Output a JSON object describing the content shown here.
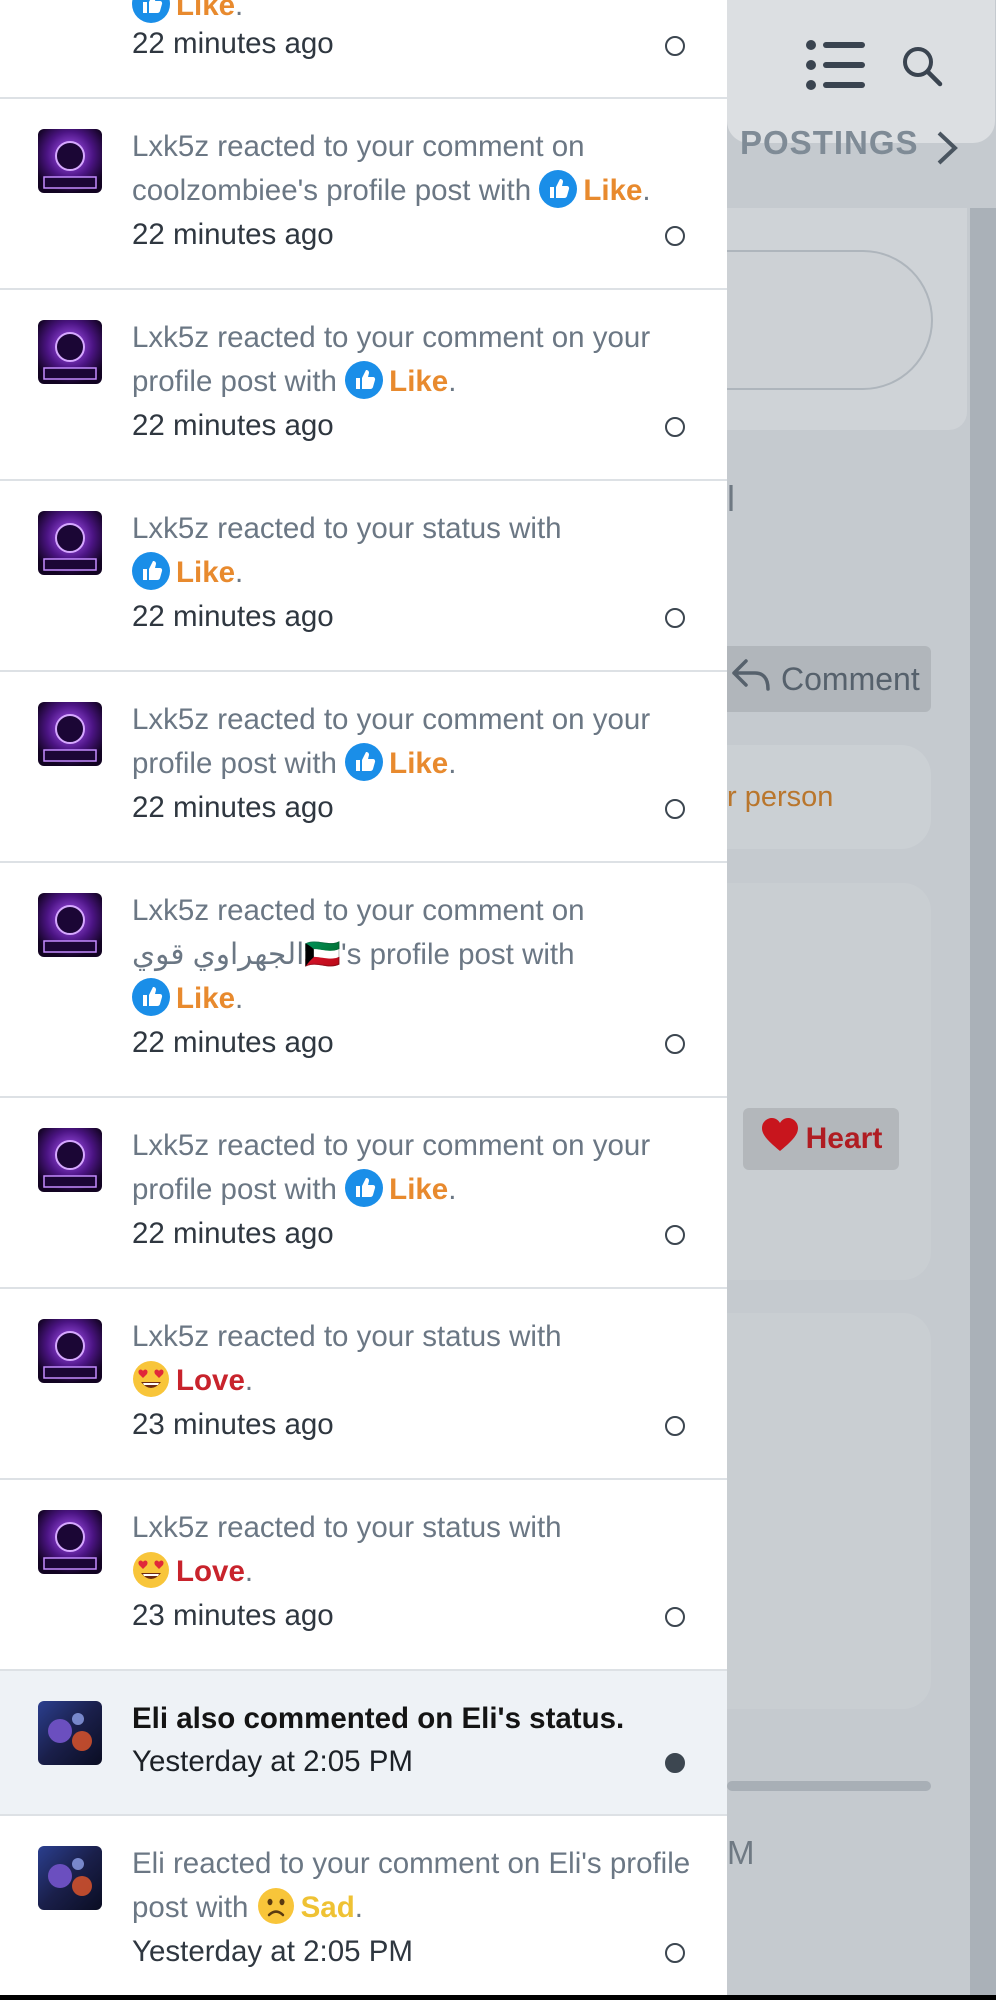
{
  "background": {
    "nav_label": "POSTINGS",
    "comment_button": "Comment",
    "pill_text": "r person",
    "heart_button": "Heart",
    "time_fragment": "M",
    "bracket": "l"
  },
  "notifications": [
    {
      "actor": "Lxk5z",
      "text": "",
      "reaction": "Like",
      "reaction_type": "like",
      "time": "22 minutes ago",
      "read": true
    },
    {
      "actor": "Lxk5z",
      "text": "Lxk5z reacted to your comment on coolzombiee's profile post with",
      "reaction": "Like",
      "reaction_type": "like",
      "time": "22 minutes ago",
      "read": true
    },
    {
      "actor": "Lxk5z",
      "text": "Lxk5z reacted to your comment on your profile post with",
      "reaction": "Like",
      "reaction_type": "like",
      "time": "22 minutes ago",
      "read": true
    },
    {
      "actor": "Lxk5z",
      "text": "Lxk5z reacted to your status with",
      "reaction": "Like",
      "reaction_type": "like",
      "time": "22 minutes ago",
      "read": true
    },
    {
      "actor": "Lxk5z",
      "text": "Lxk5z reacted to your comment on your profile post with",
      "reaction": "Like",
      "reaction_type": "like",
      "time": "22 minutes ago",
      "read": true
    },
    {
      "actor": "Lxk5z",
      "text": "Lxk5z reacted to your comment on الجهراوي قوي🇰🇼's profile post with",
      "reaction": "Like",
      "reaction_type": "like",
      "time": "22 minutes ago",
      "read": true
    },
    {
      "actor": "Lxk5z",
      "text": "Lxk5z reacted to your comment on your profile post with",
      "reaction": "Like",
      "reaction_type": "like",
      "time": "22 minutes ago",
      "read": true
    },
    {
      "actor": "Lxk5z",
      "text": "Lxk5z reacted to your status with",
      "reaction": "Love",
      "reaction_type": "love",
      "time": "23 minutes ago",
      "read": true
    },
    {
      "actor": "Lxk5z",
      "text": "Lxk5z reacted to your status with",
      "reaction": "Love",
      "reaction_type": "love",
      "time": "23 minutes ago",
      "read": true
    },
    {
      "actor": "Eli",
      "text": "Eli also commented on Eli's status.",
      "reaction": "",
      "reaction_type": "",
      "time": "Yesterday at 2:05 PM",
      "read": false
    },
    {
      "actor": "Eli",
      "text": "Eli reacted to your comment on Eli's profile post with",
      "reaction": "Sad",
      "reaction_type": "sad",
      "time": "Yesterday at 2:05 PM",
      "read": true
    }
  ],
  "icons": {
    "menu": "list-menu-icon",
    "search": "search-icon",
    "like": "thumbs-up-icon",
    "love": "heart-eyes-emoji-icon",
    "sad": "sad-face-emoji-icon",
    "reply": "reply-arrow-icon",
    "heart": "heart-icon",
    "chevron": "chevron-right-icon"
  },
  "colors": {
    "like": "#e88a2e",
    "love": "#c8232c",
    "sad": "#efc234",
    "like_badge": "#1a8ee8",
    "unread_bg": "#eef2f6"
  }
}
